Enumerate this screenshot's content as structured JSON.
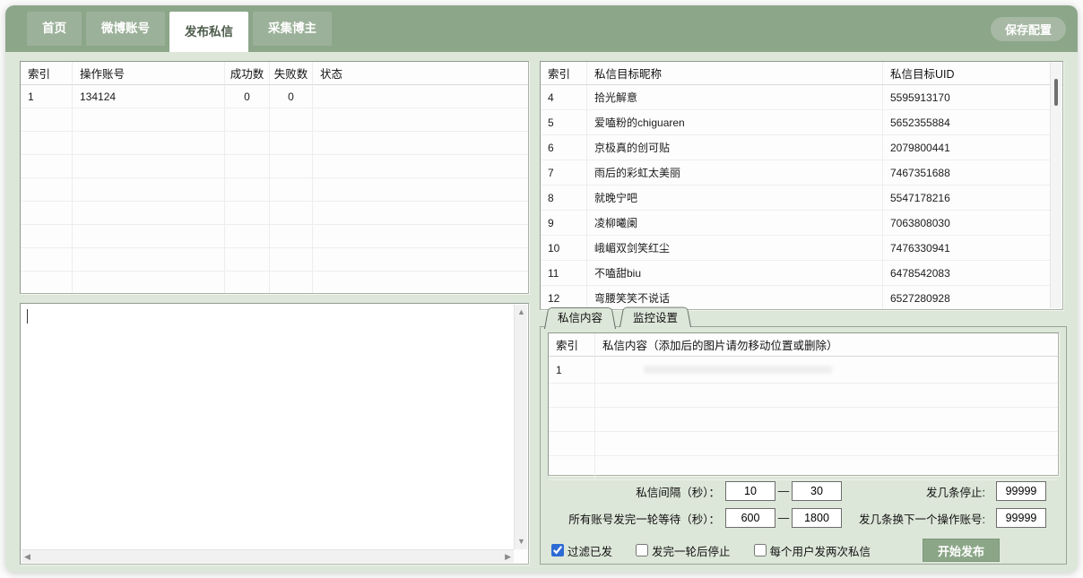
{
  "colors": {
    "header_green": "#8ca689",
    "tab_inactive": "#9cb199",
    "content_bg": "#dde7d9",
    "accent_button": "#8ba687",
    "checkbox_blue": "#2e6bd4"
  },
  "header": {
    "tabs": [
      {
        "label": "首页",
        "active": false
      },
      {
        "label": "微博账号",
        "active": false
      },
      {
        "label": "发布私信",
        "active": true
      },
      {
        "label": "采集博主",
        "active": false
      }
    ],
    "save_button": "保存配置"
  },
  "accounts_table": {
    "headers": [
      "索引",
      "操作账号",
      "成功数",
      "失败数",
      "状态"
    ],
    "rows": [
      {
        "index": "1",
        "account": "134124",
        "success": "0",
        "fail": "0",
        "status": ""
      }
    ]
  },
  "targets_table": {
    "headers": [
      "索引",
      "私信目标昵称",
      "私信目标UID"
    ],
    "rows": [
      {
        "index": "4",
        "nickname": "拾光解意",
        "uid": "5595913170"
      },
      {
        "index": "5",
        "nickname": "爱嗑粉的chiguaren",
        "uid": "5652355884"
      },
      {
        "index": "6",
        "nickname": "京极真的创可贴",
        "uid": "2079800441"
      },
      {
        "index": "7",
        "nickname": "雨后的彩虹太美丽",
        "uid": "7467351688"
      },
      {
        "index": "8",
        "nickname": "就晚宁吧",
        "uid": "5547178216"
      },
      {
        "index": "9",
        "nickname": "凌柳曦阑",
        "uid": "7063808030"
      },
      {
        "index": "10",
        "nickname": "峨嵋双剑笑红尘",
        "uid": "7476330941"
      },
      {
        "index": "11",
        "nickname": "不嗑甜biu",
        "uid": "6478542083"
      },
      {
        "index": "12",
        "nickname": "弯腰笑笑不说话",
        "uid": "6527280928"
      }
    ]
  },
  "log_area": {
    "value": ""
  },
  "dm_panel": {
    "tabs": [
      {
        "label": "私信内容",
        "active": true
      },
      {
        "label": "监控设置",
        "active": false
      }
    ],
    "table": {
      "headers": [
        "索引",
        "私信内容（添加后的图片请勿移动位置或删除）"
      ],
      "rows": [
        {
          "index": "1",
          "content": ""
        }
      ]
    },
    "settings": {
      "interval_label": "私信间隔（秒）：",
      "interval_min": "10",
      "interval_max": "30",
      "dash": "—",
      "stop_after_label": "发几条停止:",
      "stop_after_value": "99999",
      "round_wait_label": "所有账号发完一轮等待（秒）：",
      "round_wait_min": "600",
      "round_wait_max": "1800",
      "switch_account_label": "发几条换下一个操作账号:",
      "switch_account_value": "99999",
      "checkboxes": [
        {
          "label": "过滤已发",
          "checked": true
        },
        {
          "label": "发完一轮后停止",
          "checked": false
        },
        {
          "label": "每个用户发两次私信",
          "checked": false
        }
      ],
      "start_button": "开始发布"
    }
  }
}
